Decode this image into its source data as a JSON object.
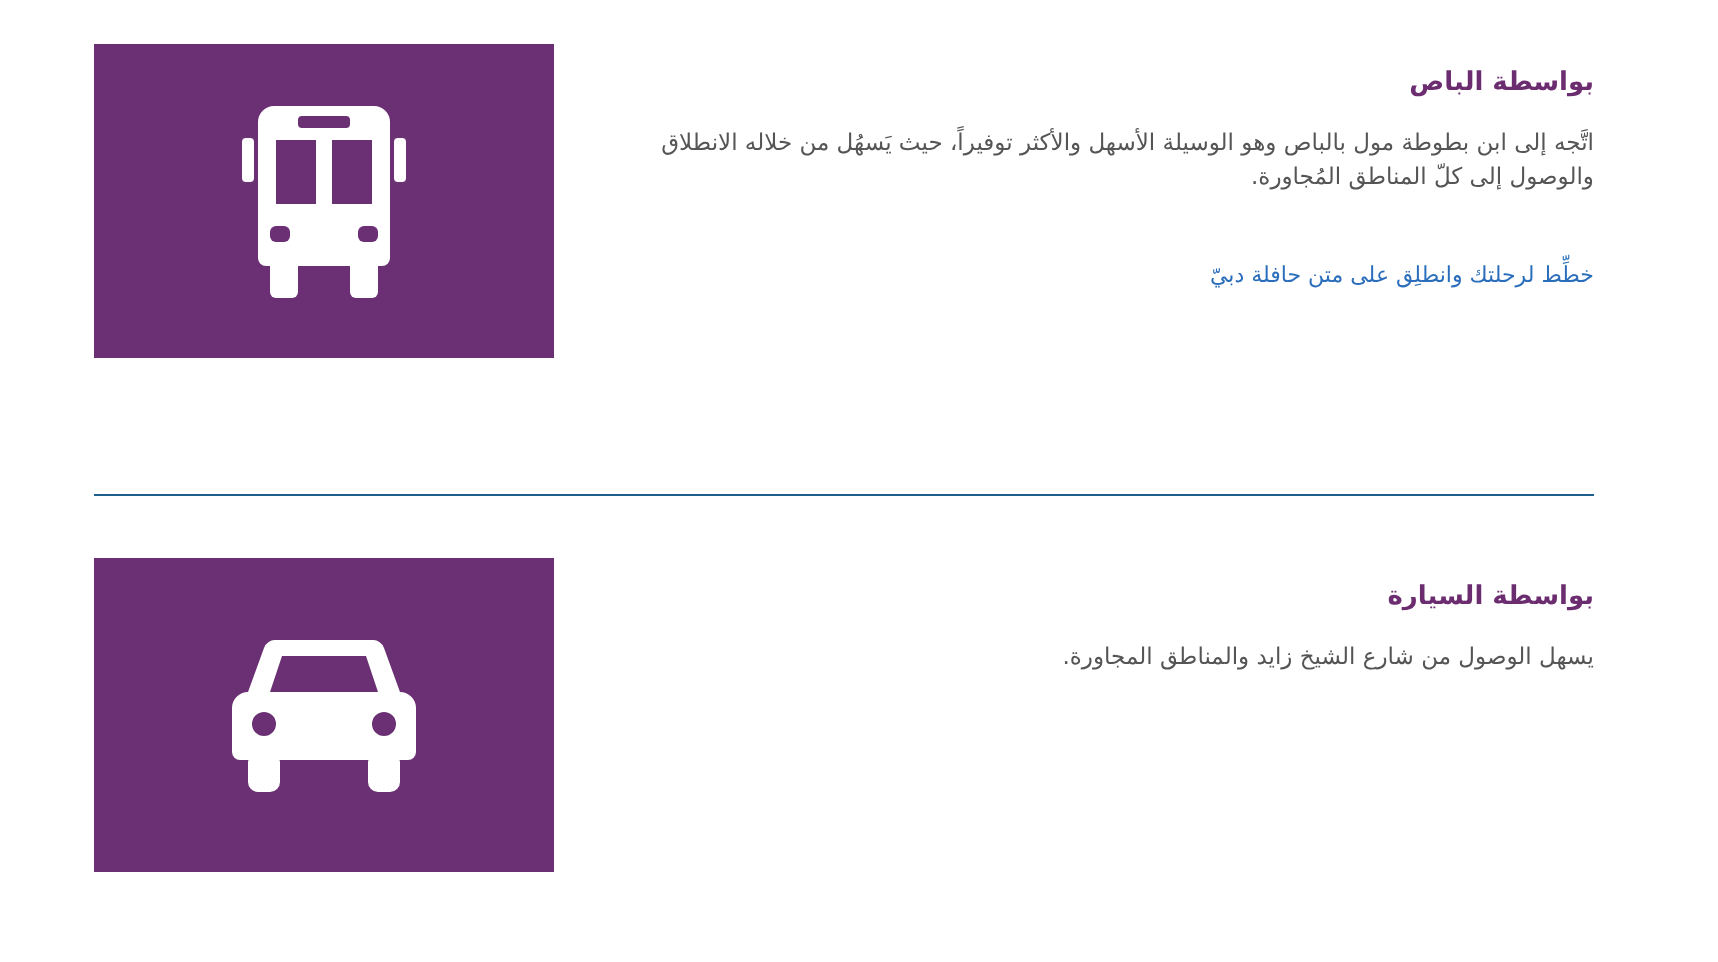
{
  "sections": [
    {
      "kind": "bus",
      "title": "بواسطة الباص",
      "text": "اتَّجه إلى ابن بطوطة مول بالباص وهو الوسيلة الأسهل والأكثر توفيراً، حيث يَسهُل من خلاله الانطلاق والوصول إلى كلّ المناطق المُجاورة.",
      "link": "خطِّط لرحلتك وانطلِق على متن حافلة دبيّ"
    },
    {
      "kind": "car",
      "title": "بواسطة السيارة",
      "text": "يسهل الوصول من شارع الشيخ زايد والمناطق المجاورة."
    }
  ]
}
